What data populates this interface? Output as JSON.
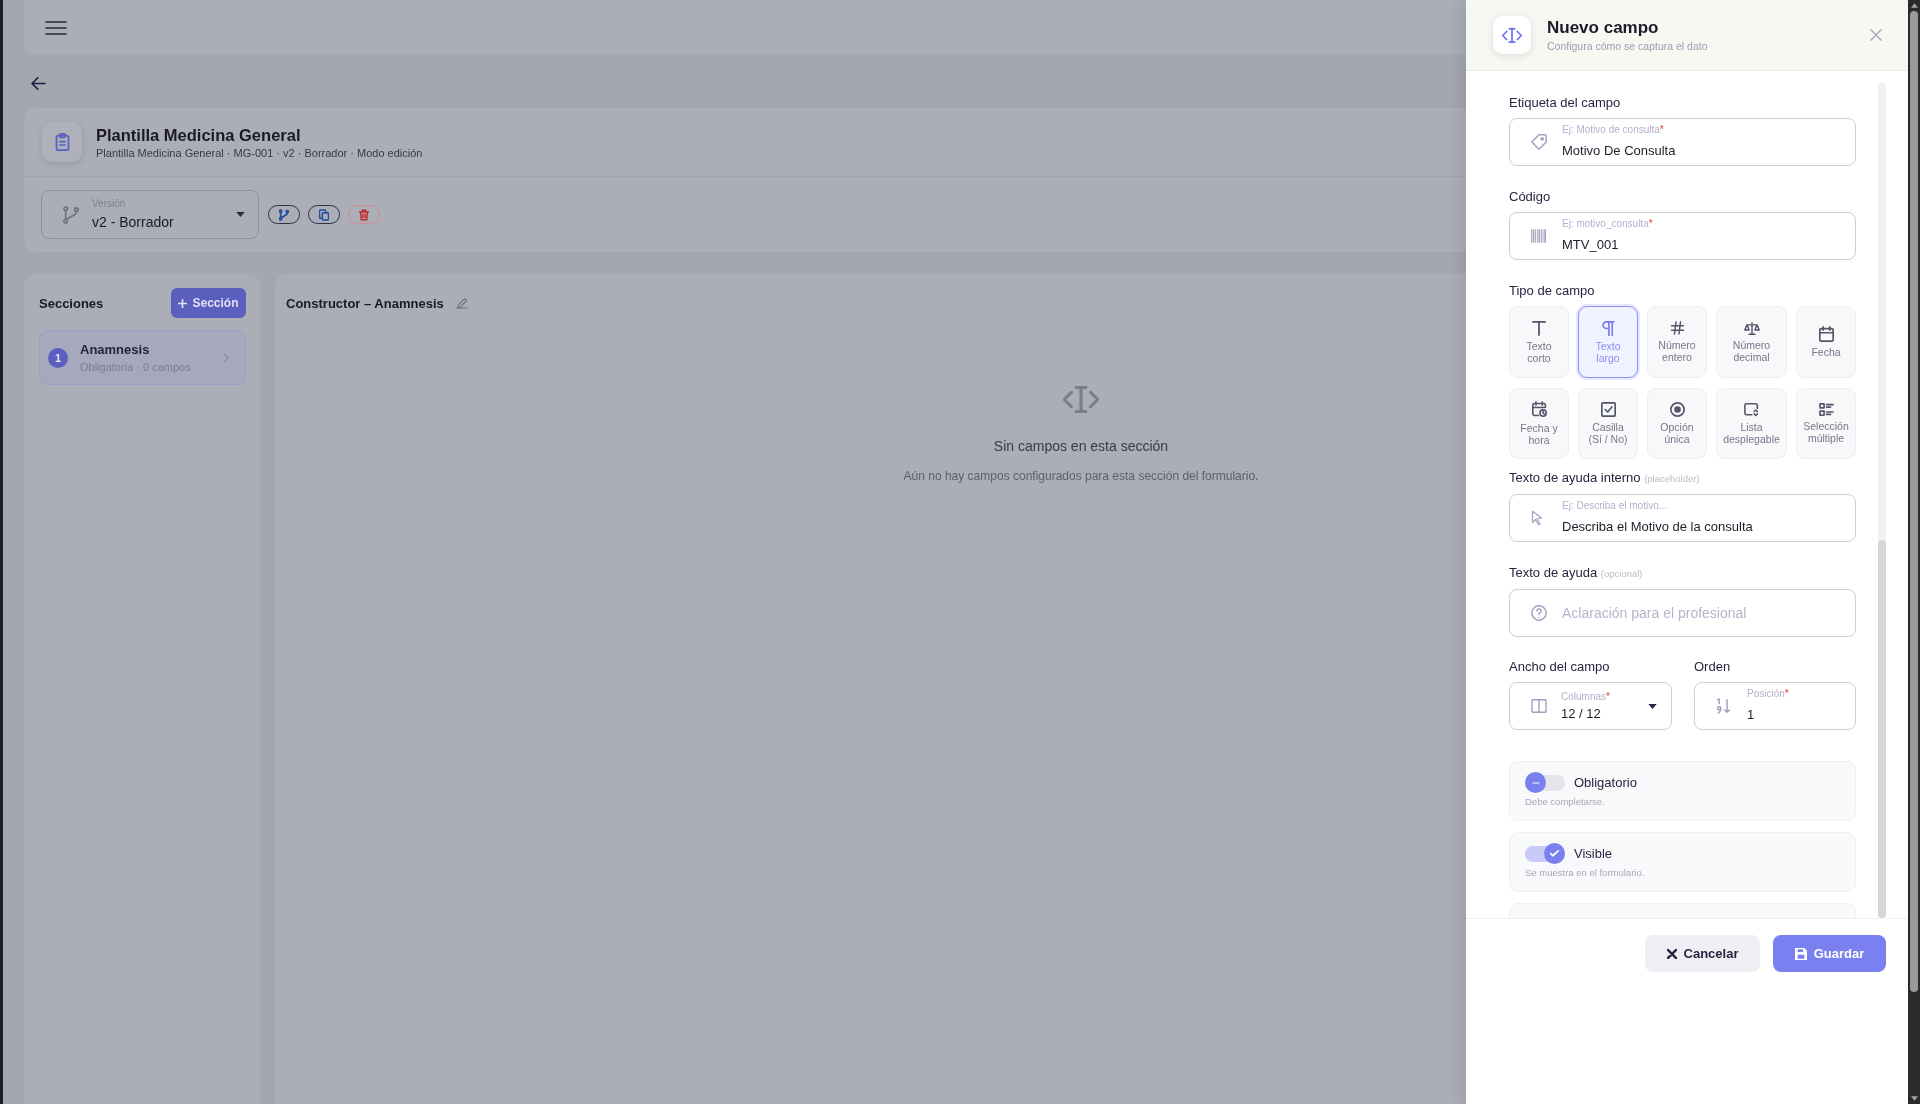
{
  "template": {
    "title": "Plantilla Medicina General",
    "subtitle": "Plantilla Medicina General · MG-001 · v2 · Borrador · Modo edición",
    "version": {
      "label": "Versión",
      "value": "v2 - Borrador"
    }
  },
  "sections": {
    "title": "Secciones",
    "add_button": "Sección",
    "items": [
      {
        "number": "1",
        "name": "Anamnesis",
        "meta": "Obligatoria · 0 campos",
        "selected": true
      }
    ]
  },
  "builder": {
    "title": "Constructor – Anamnesis",
    "empty_title": "Sin campos en esta sección",
    "empty_text": "Aún no hay campos configurados para esta sección del formulario."
  },
  "drawer": {
    "title": "Nuevo campo",
    "subtitle": "Configura cómo se captura el dato",
    "label_field": {
      "label": "Etiqueta del campo",
      "floating_label": "Ej: Motivo de consulta",
      "required_mark": "*",
      "value": "Motivo De Consulta"
    },
    "code_field": {
      "label": "Código",
      "floating_label": "Ej: motivo_consulta",
      "required_mark": "*",
      "value": "MTV_001"
    },
    "type_label": "Tipo de campo",
    "field_types": [
      {
        "kind": "short_text",
        "label": "Texto corto",
        "selected": false
      },
      {
        "kind": "long_text",
        "label": "Texto largo",
        "selected": true
      },
      {
        "kind": "integer",
        "label": "Número entero",
        "selected": false
      },
      {
        "kind": "decimal",
        "label": "Número decimal",
        "selected": false
      },
      {
        "kind": "date",
        "label": "Fecha",
        "selected": false
      },
      {
        "kind": "datetime",
        "label": "Fecha y hora",
        "selected": false
      },
      {
        "kind": "boolean",
        "label": "Casilla (Sí / No)",
        "selected": false
      },
      {
        "kind": "single_choice",
        "label": "Opción única",
        "selected": false
      },
      {
        "kind": "dropdown",
        "label": "Lista desplegable",
        "selected": false
      },
      {
        "kind": "multi_choice",
        "label": "Selección múltiple",
        "selected": false
      }
    ],
    "placeholder_field": {
      "label": "Texto de ayuda interno",
      "note": "(placeholder)",
      "floating_label": "Ej: Describa el motivo...",
      "value": "Describa el Motivo de la consulta"
    },
    "help_field": {
      "label": "Texto de ayuda",
      "note": "(opcional)",
      "placeholder": "Aclaración para el profesional"
    },
    "width_field": {
      "label": "Ancho del campo",
      "floating_label": "Columnas",
      "required_mark": "*",
      "value": "12 / 12"
    },
    "order_field": {
      "label": "Orden",
      "floating_label": "Posición",
      "required_mark": "*",
      "value": "1"
    },
    "switches": [
      {
        "label": "Obligatorio",
        "description": "Debe completarse.",
        "on": false
      },
      {
        "label": "Visible",
        "description": "Se muestra en el formulario.",
        "on": true
      }
    ],
    "cancel_button": "Cancelar",
    "save_button": "Guardar"
  }
}
